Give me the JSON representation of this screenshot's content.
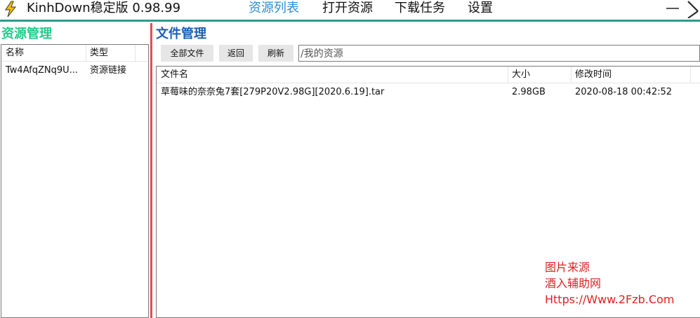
{
  "app": {
    "title": "KinhDown稳定版 0.98.99",
    "logo_icon": "lightning-bolt-icon"
  },
  "nav": {
    "items": [
      {
        "label": "资源列表",
        "active": true
      },
      {
        "label": "打开资源",
        "active": false
      },
      {
        "label": "下载任务",
        "active": false
      },
      {
        "label": "设置",
        "active": false
      }
    ]
  },
  "window_controls": {
    "minimize_icon": "minimize-icon",
    "close_icon": "close-icon"
  },
  "resource_panel": {
    "title": "资源管理",
    "columns": [
      "名称",
      "类型"
    ],
    "rows": [
      {
        "name": "Tw4AfqZNq9U...",
        "type": "资源链接"
      }
    ]
  },
  "file_panel": {
    "title": "文件管理",
    "buttons": {
      "all_files": "全部文件",
      "back": "返回",
      "refresh": "刷新"
    },
    "path": "/我的资源",
    "columns": [
      "文件名",
      "大小",
      "修改时间"
    ],
    "rows": [
      {
        "name": "草莓味的奈奈兔7套[279P20V2.98G][2020.6.19].tar",
        "size": "2.98GB",
        "modified": "2020-08-18 00:42:52"
      }
    ]
  },
  "watermark": {
    "line1": "图片来源",
    "line2": "酒入辅助网",
    "line3": "Https://Www.2Fzb.Com"
  },
  "colors": {
    "accent_teal": "#2e9b8c",
    "nav_active": "#2a8fd6",
    "left_title_green": "#1fcc8a",
    "right_title_blue": "#1a5fb4",
    "splitter_red": "#d9534f",
    "watermark_red": "#e02020"
  }
}
